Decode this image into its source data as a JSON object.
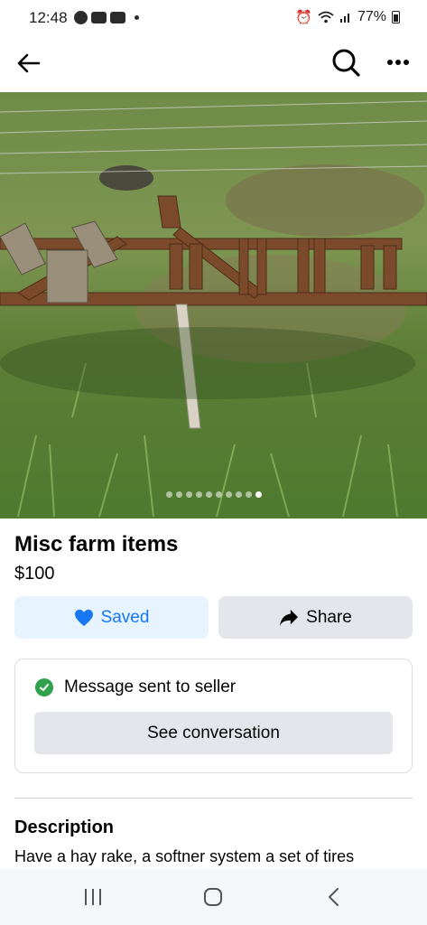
{
  "status_bar": {
    "time": "12:48",
    "notification_icons": [
      "messenger-icon",
      "youtube-icon",
      "youtube-icon"
    ],
    "battery": "77%"
  },
  "app_bar": {
    "icons": [
      "back-arrow-icon",
      "search-icon",
      "more-icon"
    ]
  },
  "photo": {
    "image_count": 10,
    "active_index": 9
  },
  "listing": {
    "title": "Misc farm items",
    "price": "$100",
    "saved_label": "Saved",
    "share_label": "Share"
  },
  "seller_message": {
    "status": "Message sent to seller",
    "button_label": "See conversation"
  },
  "description": {
    "heading": "Description",
    "text": "Have a hay rake, a softner system a set of tires"
  },
  "colors": {
    "accent": "#1877f2",
    "saved_bg": "#e7f3ff",
    "button_bg": "#e4e6eb",
    "success": "#31a24c"
  }
}
